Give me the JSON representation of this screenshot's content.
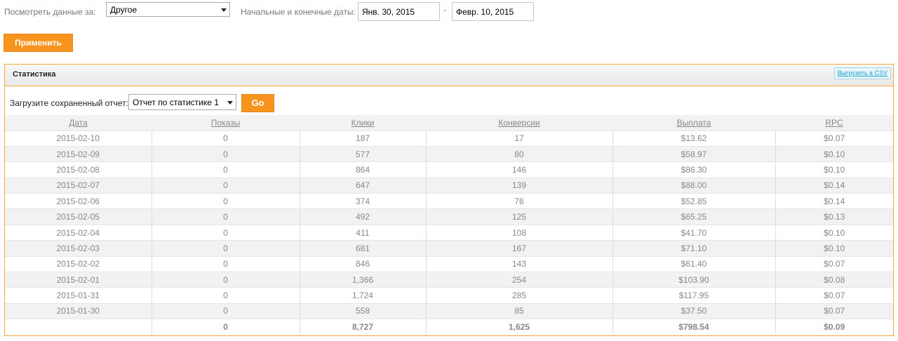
{
  "filters": {
    "period_label": "Посмотреть данные за:",
    "period_value": "Другое",
    "dates_label": "Начальные и конечные даты:",
    "start_date": "Янв. 30, 2015",
    "date_separator": "-",
    "end_date": "Февр. 10, 2015",
    "apply_label": "Применить"
  },
  "panel": {
    "title": "Статистика",
    "csv_label": "Выгрузить в CSV",
    "saved_report_label": "Загрузите сохраненный отчет:",
    "saved_report_value": "Отчет по статистике 1",
    "go_label": "Go"
  },
  "table": {
    "columns": [
      "Дата",
      "Показы",
      "Клики",
      "Конверсии",
      "Выплата",
      "RPC"
    ],
    "rows": [
      [
        "2015-02-10",
        "0",
        "187",
        "17",
        "$13.62",
        "$0.07"
      ],
      [
        "2015-02-09",
        "0",
        "577",
        "80",
        "$58.97",
        "$0.10"
      ],
      [
        "2015-02-08",
        "0",
        "864",
        "146",
        "$86.30",
        "$0.10"
      ],
      [
        "2015-02-07",
        "0",
        "647",
        "139",
        "$88.00",
        "$0.14"
      ],
      [
        "2015-02-06",
        "0",
        "374",
        "76",
        "$52.85",
        "$0.14"
      ],
      [
        "2015-02-05",
        "0",
        "492",
        "125",
        "$65.25",
        "$0.13"
      ],
      [
        "2015-02-04",
        "0",
        "411",
        "108",
        "$41.70",
        "$0.10"
      ],
      [
        "2015-02-03",
        "0",
        "681",
        "167",
        "$71.10",
        "$0.10"
      ],
      [
        "2015-02-02",
        "0",
        "846",
        "143",
        "$61.40",
        "$0.07"
      ],
      [
        "2015-02-01",
        "0",
        "1,366",
        "254",
        "$103.90",
        "$0.08"
      ],
      [
        "2015-01-31",
        "0",
        "1,724",
        "285",
        "$117.95",
        "$0.07"
      ],
      [
        "2015-01-30",
        "0",
        "558",
        "85",
        "$37.50",
        "$0.07"
      ]
    ],
    "totals": [
      "",
      "0",
      "8,727",
      "1,625",
      "$798.54",
      "$0.09"
    ]
  },
  "colors": {
    "accent": "#f7941d",
    "panel_border": "#f7a535",
    "link": "#1a9fd4"
  }
}
